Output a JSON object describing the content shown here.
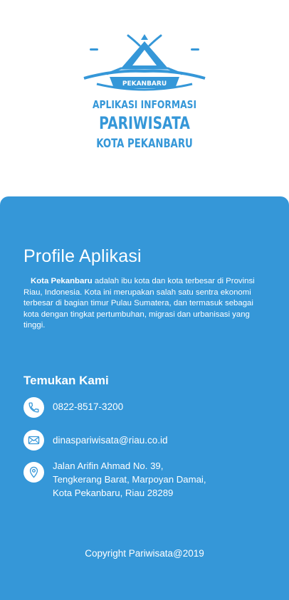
{
  "logo": {
    "badge_text": "PEKANBARU",
    "line1": "APLIKASI INFORMASI",
    "line2": "PARIWISATA",
    "line3": "KOTA PEKANBARU"
  },
  "profile": {
    "title": "Profile Aplikasi",
    "description_bold": "Kota Pekanbaru",
    "description_rest": " adalah ibu kota dan kota terbesar di Provinsi Riau, Indonesia. Kota ini merupakan salah satu sentra ekonomi terbesar di bagian timur Pulau Sumatera, dan termasuk sebagai kota dengan tingkat pertumbuhan, migrasi dan urbanisasi yang tinggi."
  },
  "contact": {
    "title": "Temukan Kami",
    "phone": "0822-8517-3200",
    "email": "dinaspariwisata@riau.co.id",
    "address_lines": [
      "Jalan Arifin Ahmad No. 39,",
      "Tengkerang Barat, Marpoyan Damai,",
      "Kota Pekanbaru, Riau 28289"
    ]
  },
  "footer": {
    "copyright": "Copyright Pariwisata@2019"
  },
  "icons": {
    "phone": "phone-icon",
    "email": "envelope-icon",
    "address": "map-pin-icon"
  },
  "colors": {
    "primary": "#3597d8",
    "background": "#ffffff",
    "text_on_primary": "#ffffff"
  }
}
